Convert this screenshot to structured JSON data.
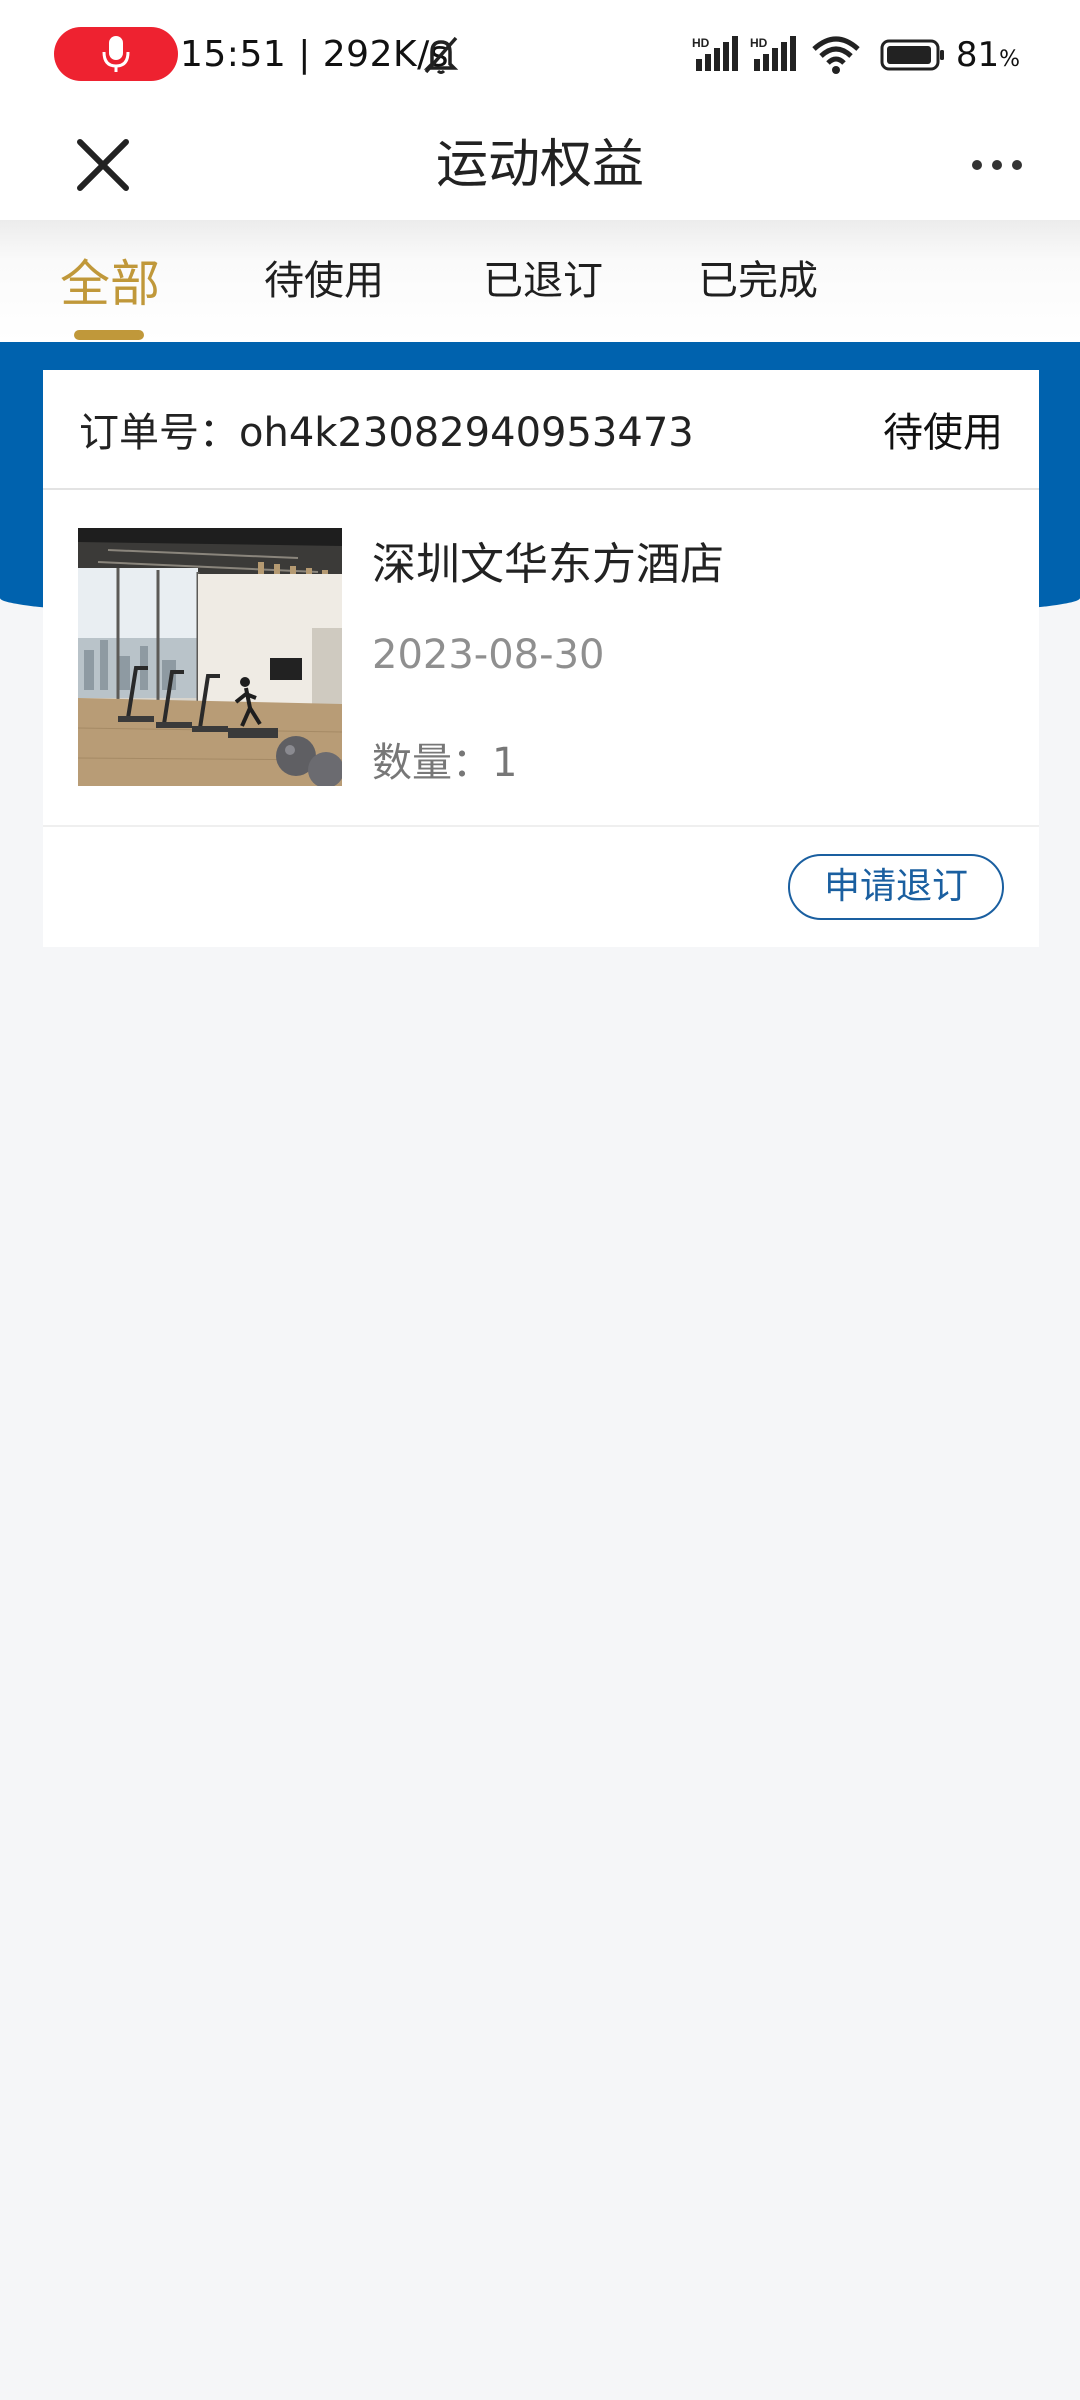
{
  "status_bar": {
    "time_speed": "15:51 | 292K/s",
    "battery": "81",
    "battery_unit": "%",
    "icons": [
      "mic-icon",
      "bell-muted-icon",
      "signal-hd-icon",
      "signal-hd-icon",
      "wifi-icon",
      "battery-icon"
    ],
    "recording_color": "#ee2230"
  },
  "header": {
    "title": "运动权益",
    "close_icon": "close-icon",
    "more_icon": "more-icon"
  },
  "tabs": [
    {
      "label": "全部",
      "active": true
    },
    {
      "label": "待使用",
      "active": false
    },
    {
      "label": "已退订",
      "active": false
    },
    {
      "label": "已完成",
      "active": false
    }
  ],
  "colors": {
    "accent": "#c0983a",
    "brand_blue": "#0062ae",
    "button_blue": "#1a5fa0",
    "background": "#f5f6f8"
  },
  "orders": [
    {
      "order_no": "订单号：oh4k23082940953473",
      "status": "待使用",
      "image": "gym-photo",
      "name": "深圳文华东方酒店",
      "date": "2023-08-30",
      "quantity": "数量：1",
      "action": "申请退订"
    }
  ]
}
